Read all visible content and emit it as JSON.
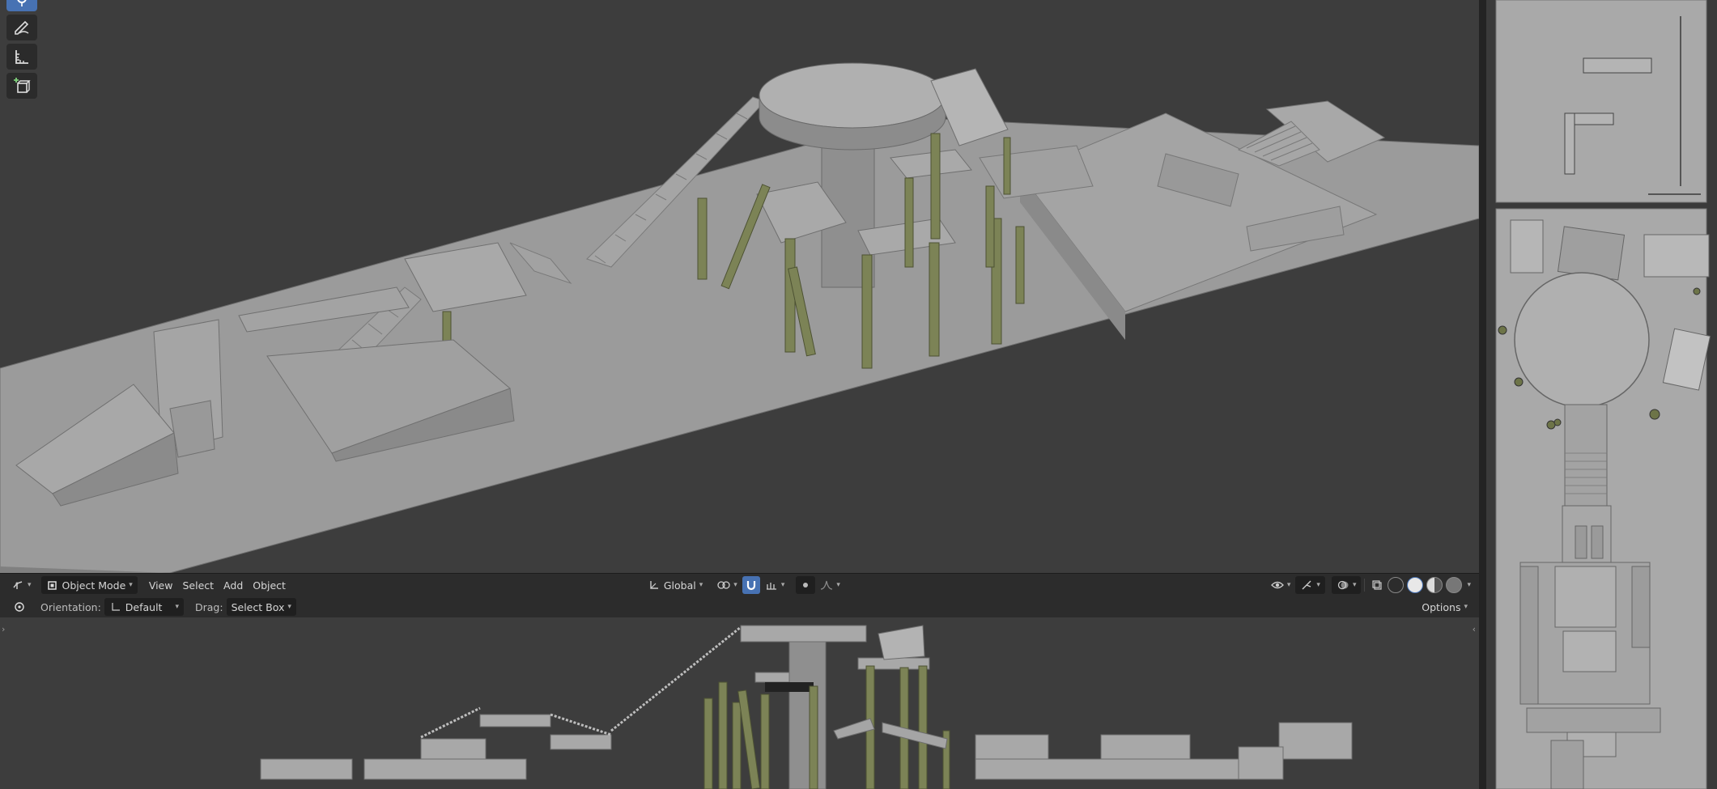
{
  "toolbar": {
    "tools": [
      {
        "name": "select-box-tool",
        "icon": "select-box-icon",
        "active": true
      },
      {
        "name": "annotate-tool",
        "icon": "annotate-pencil-icon",
        "active": false
      },
      {
        "name": "measure-tool",
        "icon": "measure-ruler-icon",
        "active": false
      },
      {
        "name": "add-cube-tool",
        "icon": "add-cube-icon",
        "active": false
      }
    ]
  },
  "header": {
    "editor_type_icon": "3d-viewport-icon",
    "mode_label": "Object Mode",
    "menus": [
      "View",
      "Select",
      "Add",
      "Object"
    ],
    "transform_orientation": "Global",
    "pivot_icon": "pivot-point-icon",
    "snap_icon": "snap-magnet-icon",
    "proportional_icon": "proportional-edit-icon",
    "falloff_icon": "falloff-curve-icon",
    "visibility_icon": "visibility-eye-icon",
    "gizmo_icon": "gizmo-icon",
    "overlay_icon": "overlay-icon",
    "xray_icon": "xray-icon",
    "shading_modes": [
      "wireframe",
      "solid",
      "material-preview",
      "rendered"
    ],
    "active_shading": "solid"
  },
  "tool_options": {
    "tool_icon": "select-tool-icon",
    "orientation_label": "Orientation:",
    "orientation_value": "Default",
    "drag_label": "Drag:",
    "drag_value": "Select Box",
    "options_label": "Options"
  },
  "colors": {
    "viewport_bg": "#3d3d3d",
    "header_bg": "#2c2c2c",
    "accent_blue": "#4772b3",
    "geometry_gray": "#9b9b9b",
    "pillar_olive": "#7c8356"
  }
}
